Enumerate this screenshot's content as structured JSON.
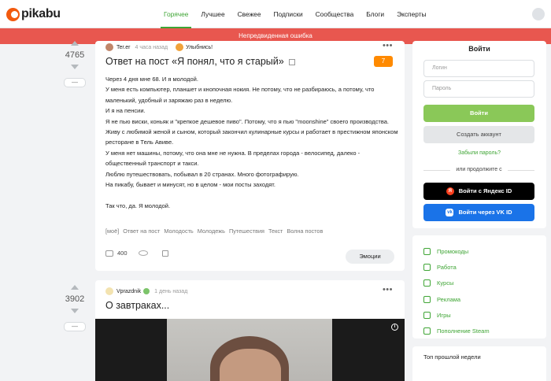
{
  "header": {
    "logo": "pikabu",
    "nav": [
      "Горячее",
      "Лучшее",
      "Свежее",
      "Подписки",
      "Сообщества",
      "Блоги",
      "Эксперты"
    ],
    "active_nav": "Горячее"
  },
  "error_bar": "Непредвиденная ошибка",
  "post1": {
    "rating": "4765",
    "minus": "—",
    "author": "Ter.er",
    "time": "4 часа назад",
    "community": "Улыбнись!",
    "menu": "•••",
    "title": "Ответ на пост «Я понял, что я старый»",
    "comments_badge": "7",
    "body": [
      "Через 4 дня мне 68. И я молодой.",
      "У меня есть компьютер, планшет и кнопочная нокия. Не потому, что не разбираюсь, а потому, что маленький, удобный и заряжаю раз в неделю.",
      "И я на пенсии.",
      "Я не пью виски, коньяк и \"крепкое дешевое пиво\". Потому, что я пью \"moonshine\" своего производства.",
      "Живу с любимой женой и сыном, который закончил кулинарные курсы и работает в престижном японском ресторане в Тель Авиве.",
      "У меня нет машины, потому, что она мне не нужна. В пределах города - велосипед, далеко - общественный транспорт и такси.",
      "Люблю путешествовать, побывал в 20 странах. Много фотографирую.",
      "На пикабу, бывает и минусят, но в целом - мои посты заходят.",
      "",
      "Так что, да. Я молодой."
    ],
    "tags": [
      "[моё]",
      "Ответ на пост",
      "Молодость",
      "Молодежь",
      "Путешествия",
      "Текст",
      "Волна постов"
    ],
    "comments_count": "400",
    "emotions_label": "Эмоции"
  },
  "post2": {
    "rating": "3902",
    "minus": "—",
    "author": "Vprazdnik",
    "time": "1 день назад",
    "menu": "•••",
    "title": "О завтраках...",
    "info": "i"
  },
  "sidebar": {
    "login_title": "Войти",
    "login_placeholder": "Логин",
    "password_placeholder": "Пароль",
    "login_button": "Войти",
    "create_account": "Создать аккаунт",
    "forgot_password": "Забыли пароль?",
    "or_continue": "или продолжите с",
    "yandex_button": "Войти с Яндекс ID",
    "yandex_icon": "Я",
    "vk_button": "Войти через VK ID",
    "vk_icon": "vk",
    "menu": [
      "Промокоды",
      "Работа",
      "Курсы",
      "Реклама",
      "Игры",
      "Пополнение Steam"
    ],
    "week_top_title": "Топ прошлой недели"
  },
  "colors": {
    "accent": "#3fa535",
    "error": "#e8574f",
    "badge": "#ff8a00",
    "login_button": "#8ac858",
    "vk": "#1a73e8"
  }
}
